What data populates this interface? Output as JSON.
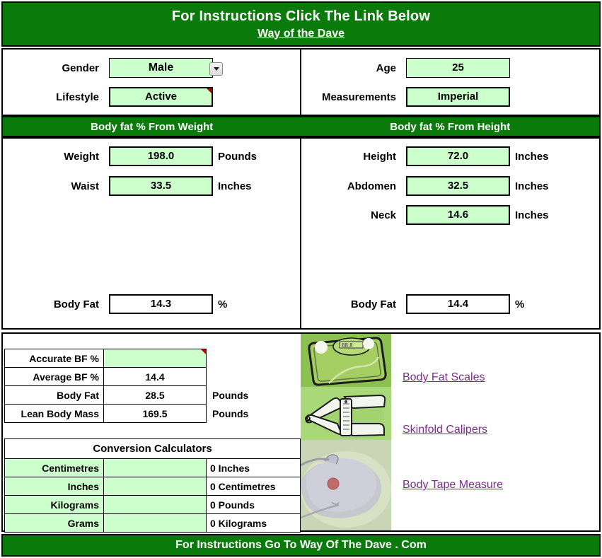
{
  "banner": {
    "title": "For Instructions Click The Link Below",
    "link_label": "Way of the Dave"
  },
  "colors": {
    "header_green": "#0a7a0a",
    "input_green": "#ccffcc",
    "link_purple": "#7b2d8b",
    "thumb_green": "#8cc152"
  },
  "top_form": {
    "left": [
      {
        "label": "Gender",
        "value": "Male",
        "control": "dropdown"
      },
      {
        "label": "Lifestyle",
        "value": "Active",
        "control": "cell",
        "comment": true
      }
    ],
    "right": [
      {
        "label": "Age",
        "value": "25",
        "control": "cell"
      },
      {
        "label": "Measurements",
        "value": "Imperial",
        "control": "cell"
      }
    ]
  },
  "sections": {
    "left_header": "Body fat % From Weight",
    "right_header": "Body fat % From Height"
  },
  "measurements": {
    "left": [
      {
        "label": "Weight",
        "value": "198.0",
        "unit": "Pounds"
      },
      {
        "label": "Waist",
        "value": "33.5",
        "unit": "Inches"
      }
    ],
    "right": [
      {
        "label": "Height",
        "value": "72.0",
        "unit": "Inches"
      },
      {
        "label": "Abdomen",
        "value": "32.5",
        "unit": "Inches"
      },
      {
        "label": "Neck",
        "value": "14.6",
        "unit": "Inches"
      }
    ]
  },
  "results": {
    "left": {
      "label": "Body Fat",
      "value": "14.3",
      "unit": "%"
    },
    "right": {
      "label": "Body Fat",
      "value": "14.4",
      "unit": "%"
    }
  },
  "summary_table": {
    "rows": [
      {
        "label": "Accurate BF %",
        "value": "",
        "unit": "",
        "editable": true,
        "comment": true
      },
      {
        "label": "Average BF %",
        "value": "14.4",
        "unit": "",
        "editable": false
      },
      {
        "label": "Body Fat",
        "value": "28.5",
        "unit": "Pounds",
        "editable": false
      },
      {
        "label": "Lean Body Mass",
        "value": "169.5",
        "unit": "Pounds",
        "editable": false
      }
    ]
  },
  "conversion": {
    "title": "Conversion Calculators",
    "rows": [
      {
        "from": "Centimetres",
        "input": "",
        "result": "0 Inches"
      },
      {
        "from": "Inches",
        "input": "",
        "result": "0 Centimetres"
      },
      {
        "from": "Kilograms",
        "input": "",
        "result": "0 Pounds"
      },
      {
        "from": "Grams",
        "input": "",
        "result": "0 Kilograms"
      }
    ]
  },
  "products": [
    {
      "link_label": "Body Fat Scales",
      "image": "bathroom-scale-image"
    },
    {
      "link_label": "Skinfold Calipers",
      "image": "skinfold-calipers-image"
    },
    {
      "link_label": "Body Tape Measure",
      "image": "body-tape-measure-image"
    }
  ],
  "footer": {
    "text": "For Instructions Go To Way Of The Dave  . Com"
  }
}
